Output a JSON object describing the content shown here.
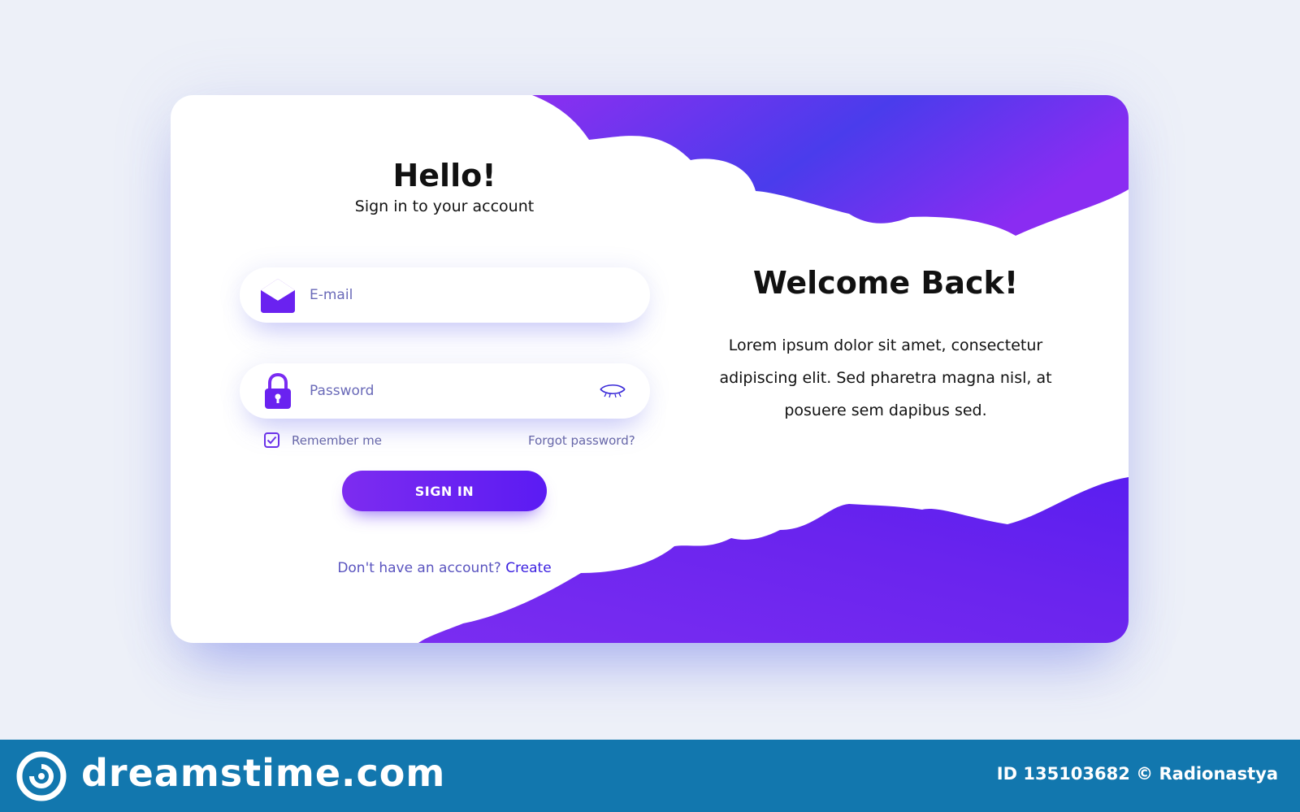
{
  "login": {
    "title": "Hello!",
    "subtitle": "Sign in to your account",
    "email_placeholder": "E-mail",
    "password_placeholder": "Password",
    "remember_label": "Remember me",
    "remember_checked": true,
    "forgot_label": "Forgot password?",
    "signin_label": "SIGN IN",
    "signup_prompt": "Don't have an account?",
    "signup_link": "Create"
  },
  "welcome": {
    "title": "Welcome Back!",
    "body": "Lorem ipsum dolor sit amet, consectetur adipiscing elit. Sed pharetra magna nisl, at posuere sem dapibus sed."
  },
  "watermark": {
    "brand": "dreamstime.com",
    "credit": "ID 135103682 © Radionastya"
  },
  "icons": {
    "email": "envelope-icon",
    "password": "lock-icon",
    "visibility": "eye-closed-icon",
    "check": "checkmark-icon",
    "brand": "spiral-logo-icon"
  },
  "colors": {
    "page_background": "#edf0f8",
    "accent_purple": "#6a1ff0",
    "accent_violet": "#8a2ef0",
    "accent_blue": "#4a36ec",
    "link_text": "#3a1fe0",
    "muted_text": "#6666a8",
    "watermark_bar": "#1277ae"
  }
}
